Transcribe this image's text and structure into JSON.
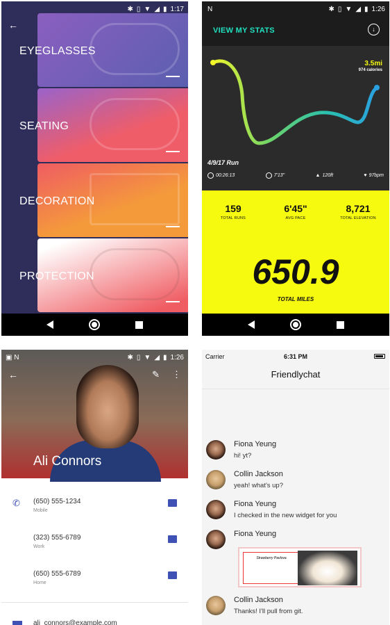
{
  "status_bars": {
    "p1_time": "1:17",
    "p2_time": "1:26",
    "p3_time": "1:26"
  },
  "p1": {
    "categories": [
      {
        "label": "EYEGLASSES",
        "color_from": "#8b5fbf",
        "color_to": "#5a5fb0"
      },
      {
        "label": "SEATING",
        "color_from": "#ef5d69",
        "color_to": "#9a63c9"
      },
      {
        "label": "DECORATION",
        "color_from": "#f49a3b",
        "color_to": "#ef5c62"
      },
      {
        "label": "PROTECTION",
        "color_from": "#ffffff",
        "color_to": "#ef5c62"
      }
    ]
  },
  "p2": {
    "header_link": "VIEW MY STATS",
    "distance": "3.5mi",
    "calories": "974 calories",
    "run_title": "4/9/17 Run",
    "run_stats": [
      "00:26:13",
      "7'13\"",
      "120ft",
      "97bpm"
    ],
    "stats": [
      {
        "value": "159",
        "label": "TOTAL RUNS"
      },
      {
        "value": "6'45\"",
        "label": "AVG PACE"
      },
      {
        "value": "8,721",
        "label": "TOTAL ELEVATION"
      }
    ],
    "total_miles": "650.9",
    "total_miles_label": "TOTAL MILES",
    "accent": "#21e0c0",
    "yellow": "#f5fa0e"
  },
  "p3": {
    "name": "Ali Connors",
    "contacts": [
      {
        "number": "(650) 555-1234",
        "type": "Mobile"
      },
      {
        "number": "(323) 555-6789",
        "type": "Work"
      },
      {
        "number": "(650) 555-6789",
        "type": "Home"
      }
    ],
    "email": "ali_connors@example.com",
    "accent": "#3f51b5"
  },
  "p4": {
    "carrier": "Carrier",
    "time": "6:31 PM",
    "title": "Friendlychat",
    "messages": [
      {
        "name": "Fiona Yeung",
        "text": "hi! yt?",
        "avatar": "fiona"
      },
      {
        "name": "Collin Jackson",
        "text": "yeah! what's up?",
        "avatar": "collin"
      },
      {
        "name": "Fiona Yeung",
        "text": "I checked in the new widget for you",
        "avatar": "fiona"
      },
      {
        "name": "Fiona Yeung",
        "text": "",
        "avatar": "fiona",
        "card_title": "Strawberry Pavlova"
      },
      {
        "name": "Collin Jackson",
        "text": "Thanks! I'll pull from git.",
        "avatar": "collin"
      }
    ]
  }
}
